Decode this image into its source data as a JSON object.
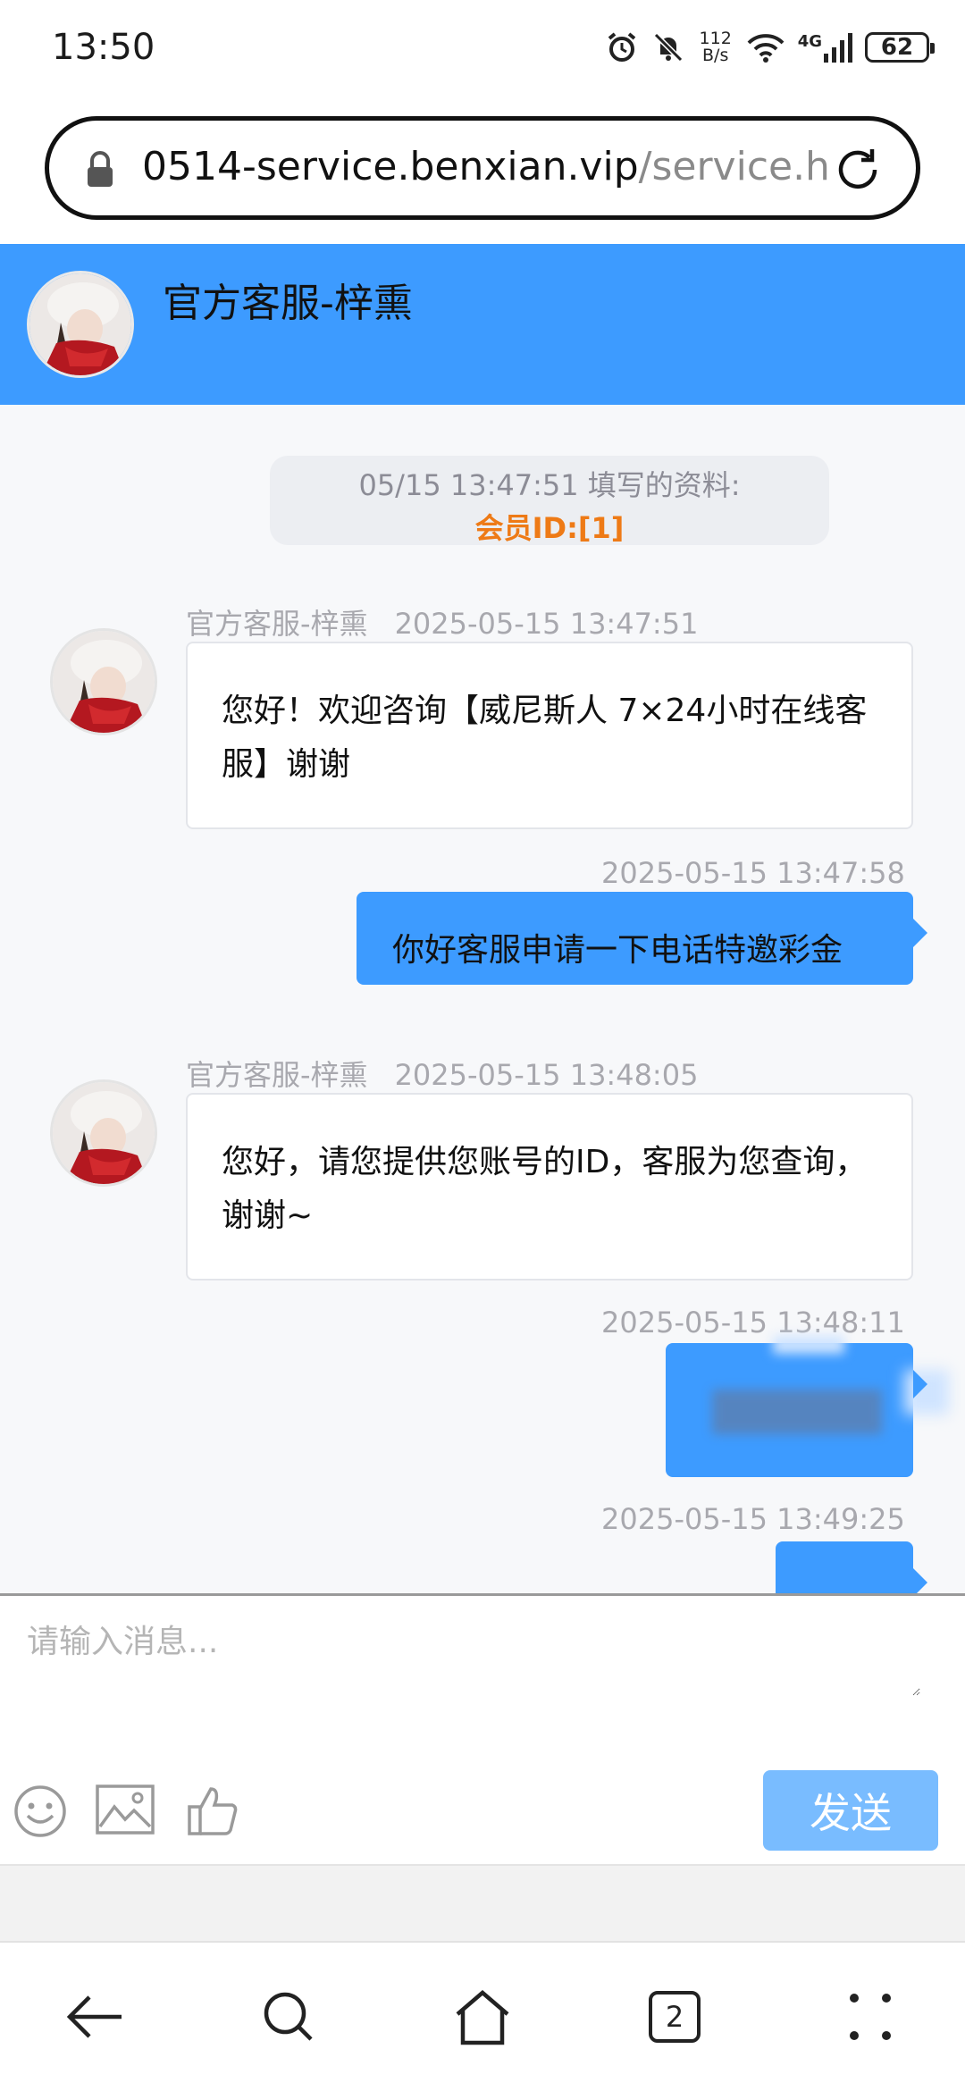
{
  "status_bar": {
    "time": "13:50",
    "net_speed_value": "112",
    "net_speed_unit": "B/s",
    "network_type": "4G",
    "battery": "62"
  },
  "url_bar": {
    "url_main": "0514-service.benxian.vip",
    "url_rest": "/service.h"
  },
  "chat": {
    "header_title": "官方客服-梓熏",
    "info_card": {
      "line1": "05/15 13:47:51 填写的资料:",
      "line2": "会员ID:[1]"
    },
    "messages": [
      {
        "direction": "in",
        "sender": "官方客服-梓熏",
        "time": "2025-05-15 13:47:51",
        "text": "您好！欢迎咨询【威尼斯人 7×24小时在线客服】谢谢"
      },
      {
        "direction": "out",
        "time": "2025-05-15 13:47:58",
        "text": "你好客服申请一下电话特邀彩金"
      },
      {
        "direction": "in",
        "sender": "官方客服-梓熏",
        "time": "2025-05-15 13:48:05",
        "text": "您好，请您提供您账号的ID，客服为您查询，谢谢~"
      },
      {
        "direction": "out",
        "time": "2025-05-15 13:48:11",
        "text": ""
      },
      {
        "direction": "out",
        "time": "2025-05-15 13:49:25",
        "text": ""
      }
    ]
  },
  "composer": {
    "placeholder": "请输入消息...",
    "send_label": "发送"
  },
  "browser_nav": {
    "tab_count": "2"
  },
  "colors": {
    "accent_blue": "#3d9bff",
    "send_button": "#79bcff",
    "info_highlight": "#ee7a16"
  }
}
